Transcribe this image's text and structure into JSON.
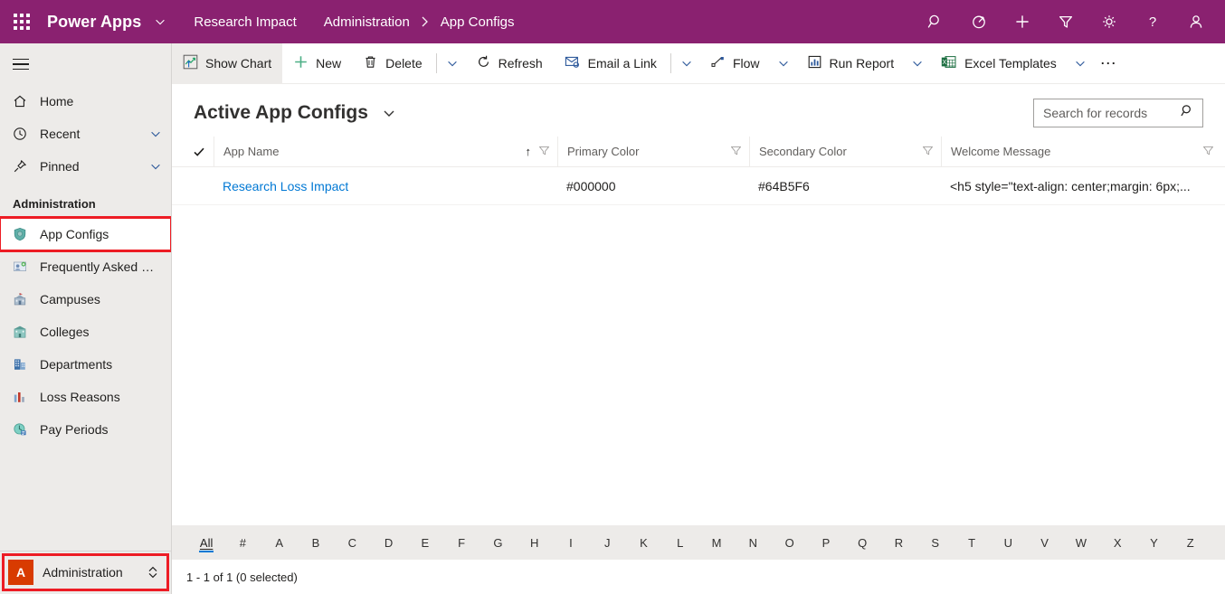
{
  "topbar": {
    "waffle_label": "app-launcher",
    "brand": "Power Apps",
    "breadcrumbs": [
      {
        "label": "Research Impact"
      },
      {
        "label": "Administration"
      },
      {
        "label": "App Configs"
      }
    ],
    "separator": "›",
    "icons": [
      {
        "name": "search-icon",
        "title": "Search"
      },
      {
        "name": "diagnostics-icon",
        "title": "Diagnostics"
      },
      {
        "name": "quick-create-icon",
        "title": "New"
      },
      {
        "name": "filter-icon",
        "title": "Filter"
      },
      {
        "name": "settings-gear-icon",
        "title": "Settings"
      },
      {
        "name": "help-icon",
        "title": "Help"
      },
      {
        "name": "user-account-icon",
        "title": "Account"
      }
    ]
  },
  "sidebar": {
    "hamburger_label": "Expand / Collapse",
    "top_items": [
      {
        "label": "Home",
        "icon": "home-icon",
        "chevron": false
      },
      {
        "label": "Recent",
        "icon": "clock-icon",
        "chevron": true
      },
      {
        "label": "Pinned",
        "icon": "pin-icon",
        "chevron": true
      }
    ],
    "group_title": "Administration",
    "entity_items": [
      {
        "label": "App Configs",
        "icon": "shield-icon",
        "selected": true,
        "highlighted": true
      },
      {
        "label": "Frequently Asked Qu...",
        "icon": "faq-icon",
        "selected": false,
        "highlighted": false
      },
      {
        "label": "Campuses",
        "icon": "campus-icon",
        "selected": false,
        "highlighted": false
      },
      {
        "label": "Colleges",
        "icon": "college-icon",
        "selected": false,
        "highlighted": false
      },
      {
        "label": "Departments",
        "icon": "department-icon",
        "selected": false,
        "highlighted": false
      },
      {
        "label": "Loss Reasons",
        "icon": "bar-chart-icon",
        "selected": false,
        "highlighted": false
      },
      {
        "label": "Pay Periods",
        "icon": "pay-period-icon",
        "selected": false,
        "highlighted": false
      }
    ],
    "area_selector": {
      "badge": "A",
      "badge_color": "#D83B01",
      "label": "Administration",
      "chevron_icon": "chevron-up-down-icon",
      "highlighted": true
    }
  },
  "commandbar": {
    "items": [
      {
        "label": "Show Chart",
        "icon": "show-chart-icon",
        "active": true,
        "caret": false,
        "sep_after": false
      },
      {
        "label": "New",
        "icon": "plus-icon",
        "active": false,
        "caret": false,
        "sep_after": false
      },
      {
        "label": "Delete",
        "icon": "trash-icon",
        "active": false,
        "caret": true,
        "sep_before": true
      },
      {
        "label": "Refresh",
        "icon": "refresh-icon",
        "active": false,
        "caret": false
      },
      {
        "label": "Email a Link",
        "icon": "email-link-icon",
        "active": false,
        "caret": true,
        "sep_before": true
      },
      {
        "label": "Flow",
        "icon": "flow-icon",
        "active": false,
        "caret": true
      },
      {
        "label": "Run Report",
        "icon": "run-report-icon",
        "active": false,
        "caret": true
      },
      {
        "label": "Excel Templates",
        "icon": "excel-icon",
        "active": false,
        "caret": true
      }
    ],
    "overflow_label": "⋯",
    "overflow_name": "more-commands-icon"
  },
  "view": {
    "title": "Active App Configs",
    "title_caret_icon": "chevron-down-icon",
    "accent_color": "#0078D4",
    "brand_color": "#8A2170"
  },
  "search": {
    "placeholder": "Search for records",
    "value": "",
    "icon": "search-icon"
  },
  "grid": {
    "select_all_icon": "checkmark-icon",
    "columns": [
      {
        "label": "App Name",
        "sorted": true,
        "sort_dir": "↑",
        "filter_icon": "filter-icon"
      },
      {
        "label": "Primary Color",
        "sorted": false,
        "sort_dir": "",
        "filter_icon": "filter-icon"
      },
      {
        "label": "Secondary Color",
        "sorted": false,
        "sort_dir": "",
        "filter_icon": "filter-icon"
      },
      {
        "label": "Welcome Message",
        "sorted": false,
        "sort_dir": "",
        "filter_icon": "filter-icon"
      }
    ],
    "rows": [
      {
        "app_name": "Research Loss Impact",
        "primary_color": "#000000",
        "secondary_color": "#64B5F6",
        "welcome_message": "<h5 style=\"text-align: center;margin: 6px;..."
      }
    ]
  },
  "footer": {
    "alphabet": [
      "All",
      "#",
      "A",
      "B",
      "C",
      "D",
      "E",
      "F",
      "G",
      "H",
      "I",
      "J",
      "K",
      "L",
      "M",
      "N",
      "O",
      "P",
      "Q",
      "R",
      "S",
      "T",
      "U",
      "V",
      "W",
      "X",
      "Y",
      "Z"
    ],
    "active_letter": "All",
    "status": "1 - 1 of 1 (0 selected)"
  }
}
